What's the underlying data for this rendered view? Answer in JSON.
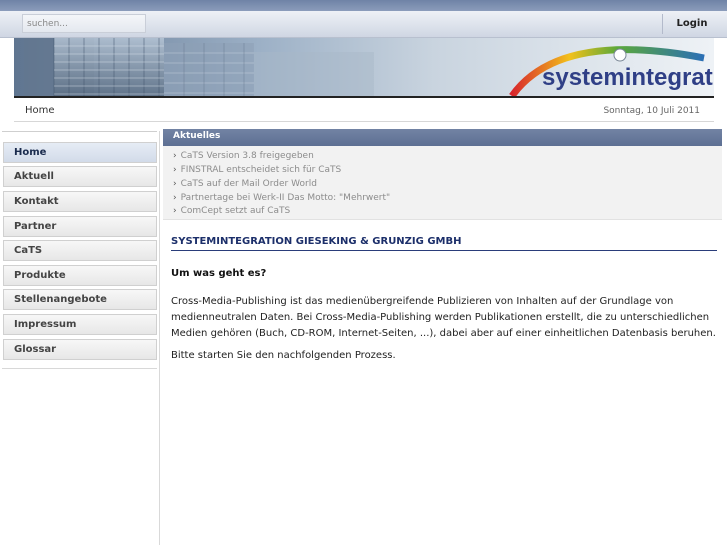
{
  "search": {
    "placeholder": "suchen..."
  },
  "header": {
    "login_label": "Login"
  },
  "banner": {
    "logo_text": "systemintegration"
  },
  "breadcrumb": {
    "home": "Home",
    "date": "Sonntag, 10 Juli 2011"
  },
  "sidebar": {
    "items": [
      {
        "label": "Home",
        "active": true
      },
      {
        "label": "Aktuell"
      },
      {
        "label": "Kontakt"
      },
      {
        "label": "Partner"
      },
      {
        "label": "CaTS"
      },
      {
        "label": "Produkte"
      },
      {
        "label": "Stellenangebote"
      },
      {
        "label": "Impressum"
      },
      {
        "label": "Glossar"
      }
    ]
  },
  "news": {
    "heading": "Aktuelles",
    "items": [
      "CaTS Version 3.8 freigegeben",
      "FINSTRAL entscheidet sich für CaTS",
      "CaTS auf der Mail Order World",
      "Partnertage bei Werk-II Das Motto: \"Mehrwert\"",
      "ComCept setzt auf CaTS"
    ]
  },
  "content": {
    "title": "SYSTEMINTEGRATION GIESEKING & GRUNZIG GMBH",
    "subtitle": "Um was geht es?",
    "paragraph1": "Cross-Media-Publishing ist das medienübergreifende Publizieren von Inhalten auf der Grundlage von medienneutralen Daten. Bei Cross-Media-Publishing werden Publikationen erstellt, die zu unterschiedlichen Medien gehören (Buch, CD-ROM, Internet-Seiten, ...), dabei aber auf einer einheitlichen Datenbasis beruhen.",
    "paragraph2": "Bitte starten Sie den nachfolgenden Prozess."
  },
  "colors": {
    "accent": "#5d6f93",
    "title": "#1c2f6a"
  }
}
